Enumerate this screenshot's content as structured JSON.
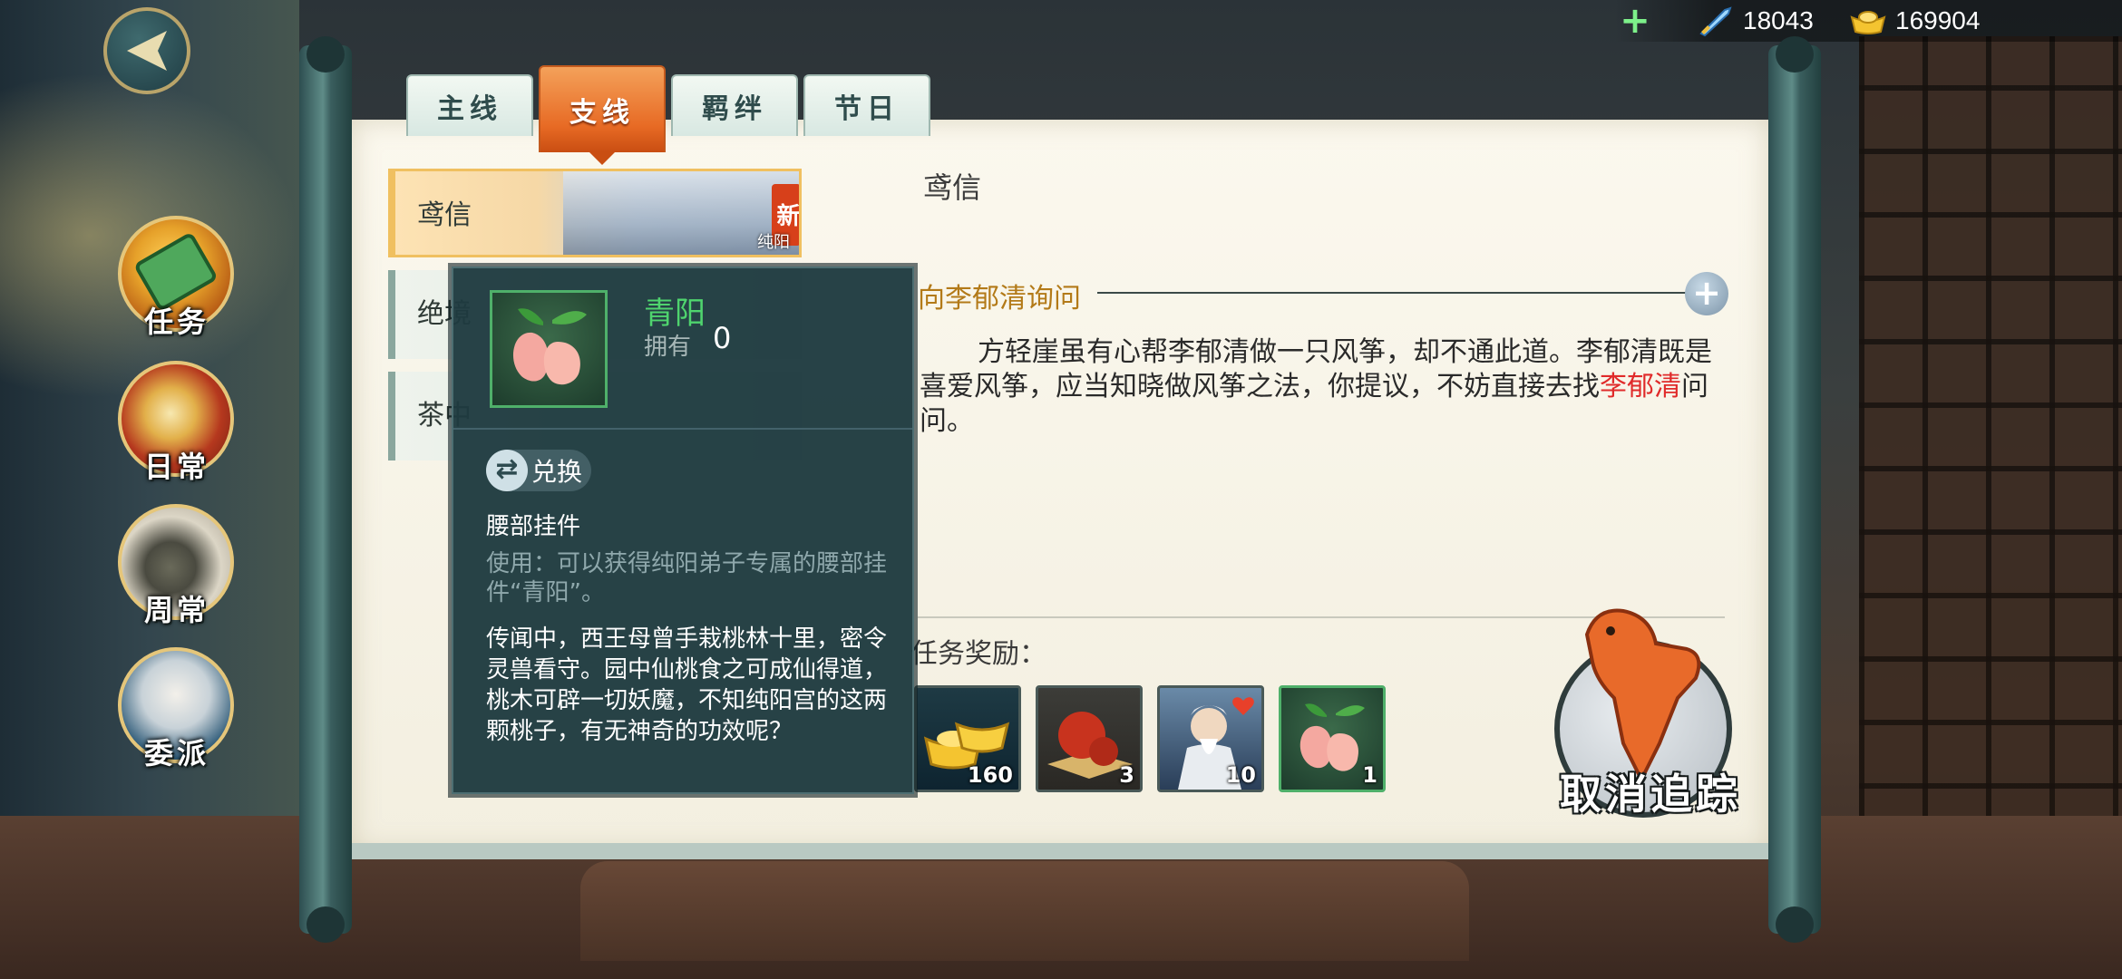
{
  "currency": {
    "plus_label": "+",
    "item1": {
      "icon": "sword-icon",
      "value": "18043"
    },
    "item2": {
      "icon": "gold-ingot-icon",
      "value": "169904"
    }
  },
  "left_menu": [
    {
      "label": "任务",
      "icon": "scroll-icon"
    },
    {
      "label": "日常",
      "icon": "daily-icon"
    },
    {
      "label": "周常",
      "icon": "weekly-icon"
    },
    {
      "label": "委派",
      "icon": "dispatch-icon"
    }
  ],
  "tabs": [
    {
      "label": "主线"
    },
    {
      "label": "支线"
    },
    {
      "label": "羁绊"
    },
    {
      "label": "节日"
    }
  ],
  "quests": [
    {
      "name": "鸢信",
      "badge": "新",
      "tag": "纯阳"
    },
    {
      "name": "绝境"
    },
    {
      "name": "茶中"
    }
  ],
  "detail": {
    "title": "鸢信",
    "objective": "向李郁清询问",
    "desc_pre": "方轻崖虽有心帮李郁清做一只风筝，却不通此道。李郁清既是喜爱风筝，应当知晓做风筝之法，你提议，不妨直接去找",
    "desc_highlight": "李郁清",
    "desc_post": "问问。",
    "reward_label": "任务奖励：",
    "rewards": [
      {
        "icon": "gold-ingot-icon",
        "count": "160"
      },
      {
        "icon": "red-fruit-icon",
        "count": "3"
      },
      {
        "icon": "elder-portrait-icon",
        "count": "10"
      },
      {
        "icon": "peach-icon",
        "count": "1"
      }
    ],
    "cancel_track_label": "取消追踪"
  },
  "tooltip": {
    "name": "青阳",
    "own_label": "拥有",
    "own_value": "0",
    "exchange_label": "兑换",
    "type": "腰部挂件",
    "use": "使用：可以获得纯阳弟子专属的腰部挂件“青阳”。",
    "lore": "传闻中，西王母曾手栽桃林十里，密令灵兽看守。园中仙桃食之可成仙得道，桃木可辟一切妖魔，不知纯阳宫的这两颗桃子，有无神奇的功效呢？"
  }
}
